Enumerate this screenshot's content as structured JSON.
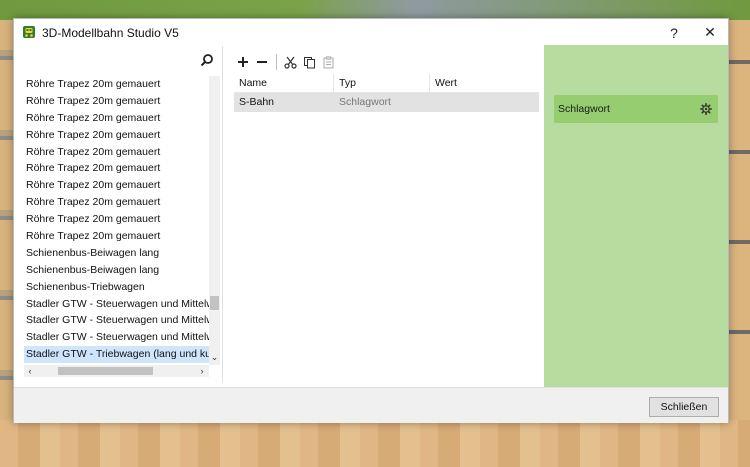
{
  "window": {
    "title": "3D-Modellbahn Studio V5",
    "help_label": "?",
    "close_label": "✕"
  },
  "list": {
    "items": [
      "Röhre Trapez 20m gemauert",
      "Röhre Trapez 20m gemauert",
      "Röhre Trapez 20m gemauert",
      "Röhre Trapez 20m gemauert",
      "Röhre Trapez 20m gemauert",
      "Röhre Trapez 20m gemauert",
      "Röhre Trapez 20m gemauert",
      "Röhre Trapez 20m gemauert",
      "Röhre Trapez 20m gemauert",
      "Röhre Trapez 20m gemauert",
      "Schienenbus-Beiwagen lang",
      "Schienenbus-Beiwagen lang",
      "Schienenbus-Triebwagen",
      "Stadler GTW - Steuerwagen und Mittelwagen",
      "Stadler GTW - Steuerwagen und Mittelwagen",
      "Stadler GTW - Steuerwagen und Mittelwagen",
      "Stadler GTW - Triebwagen (lang und kurz)"
    ],
    "selected_index": 16
  },
  "properties": {
    "columns": [
      "Name",
      "Typ",
      "Wert"
    ],
    "rows": [
      {
        "name": "S-Bahn",
        "type": "Schlagwort",
        "value": ""
      }
    ]
  },
  "tag_panel": {
    "label": "Schlagwort"
  },
  "footer": {
    "close_button": "Schließen"
  },
  "icons": {
    "app": "app-icon",
    "search": "search-icon",
    "add": "plus-icon",
    "remove": "minus-icon",
    "cut": "scissors-icon",
    "copy": "copy-icon",
    "paste": "paste-icon",
    "settings": "gear-icon"
  },
  "colors": {
    "tag_panel_bg": "#b7dc9f",
    "tag_row_bg": "#96cd70",
    "selection": "#cfe5fb",
    "row_highlight": "#e2e2e2"
  }
}
